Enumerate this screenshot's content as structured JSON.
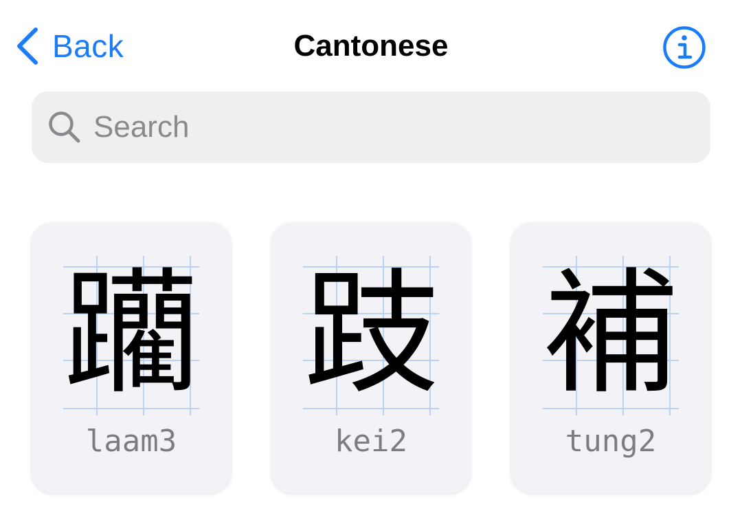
{
  "nav": {
    "back_label": "Back",
    "title": "Cantonese",
    "back_icon": "chevron-left-icon",
    "info_icon": "info-circle-icon",
    "accent_color": "#1a7cf6"
  },
  "search": {
    "placeholder": "Search",
    "value": "",
    "icon": "magnifier-icon"
  },
  "characters": [
    {
      "hanzi": "躪",
      "romanization": "laam3"
    },
    {
      "hanzi": "跂",
      "romanization": "kei2"
    },
    {
      "hanzi": "補",
      "romanization": "tung2"
    }
  ]
}
